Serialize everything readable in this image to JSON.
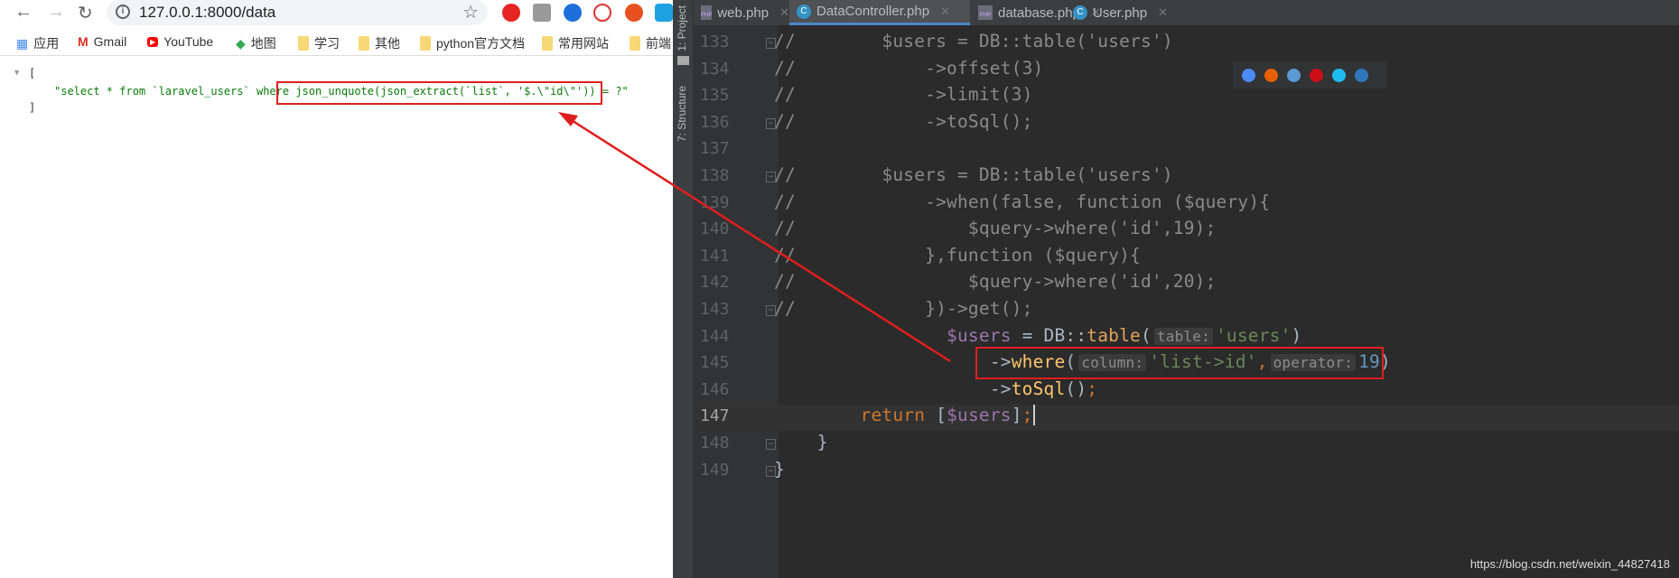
{
  "browser": {
    "url": "127.0.0.1:8000/data",
    "bookmarks": [
      "应用",
      "Gmail",
      "YouTube",
      "地图",
      "学习",
      "其他",
      "python官方文档",
      "常用网站",
      "前端"
    ],
    "json": {
      "open": "[",
      "close": "]",
      "value_plain": "\"select * from `laravel_users` where ",
      "value_highlight": "json_unquote(json_extract(`list`, '$.\\\"id\\\"')) = ?\""
    }
  },
  "ide": {
    "side_tools": [
      "1: Project",
      "7: Structure"
    ],
    "tabs": [
      {
        "label": "web.php",
        "icon": "php-file-icon"
      },
      {
        "label": "DataController.php",
        "icon": "class-icon",
        "active": true
      },
      {
        "label": "database.php",
        "icon": "php-file-icon"
      },
      {
        "label": "User.php",
        "icon": "class-icon"
      }
    ],
    "line_numbers": [
      "133",
      "134",
      "135",
      "136",
      "137",
      "138",
      "139",
      "140",
      "141",
      "142",
      "143",
      "144",
      "145",
      "146",
      "147",
      "148",
      "149"
    ],
    "comment_lines": [
      "//        $users = DB::table('users')",
      "//            ->offset(3)",
      "//            ->limit(3)",
      "//            ->toSql();",
      "",
      "//        $users = DB::table('users')",
      "//            ->when(false, function ($query){",
      "//                $query->where('id',19);",
      "//            },function ($query){",
      "//                $query->where('id',20);",
      "//            })->get();"
    ],
    "l144": {
      "indent": "                ",
      "var": "$users",
      "op": " = DB::",
      "fn": "table",
      "p": "(",
      "hint": "table:",
      "str": "'users'",
      "close": ")"
    },
    "l145": {
      "indent": "                    ",
      "arrow": "->",
      "meth": "where",
      "p": "(",
      "hint1": "column:",
      "str": "'list->id'",
      "comma": ",",
      "hint2": "operator:",
      "num": "19",
      "close": ")"
    },
    "l146": {
      "indent": "                    ",
      "arrow": "->",
      "meth": "toSql",
      "rest": "()",
      "semi": ";"
    },
    "l147": {
      "indent": "        ",
      "kw": "return",
      "b1": " [",
      "var": "$users",
      "b2": "]",
      "semi": ";"
    },
    "l148": "    }",
    "l149": "}",
    "watermark": "https://blog.csdn.net/weixin_44827418"
  },
  "colors": {
    "annotation": "#e01e1e",
    "accent": "#4a88c7"
  }
}
